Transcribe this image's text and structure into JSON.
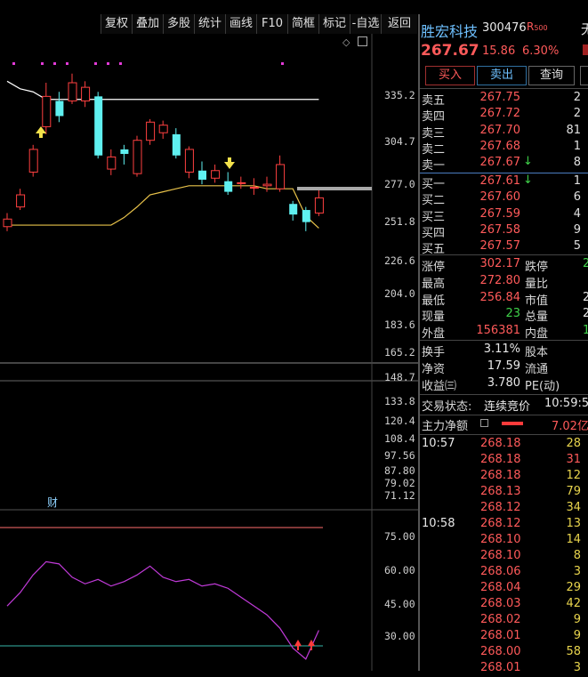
{
  "toolbar": {
    "items": [
      "复权",
      "叠加",
      "多股",
      "统计",
      "画线",
      "F10",
      "简框",
      "标记",
      "-自选",
      "返回"
    ]
  },
  "axis": {
    "price_ticks": [
      "335.2",
      "304.7",
      "277.0",
      "251.8",
      "226.6",
      "204.0",
      "183.6",
      "165.2",
      "148.7",
      "133.8",
      "120.4",
      "108.4",
      "97.56",
      "87.80",
      "79.02",
      "71.12"
    ],
    "indicator_ticks": [
      "75.00",
      "60.00",
      "45.00",
      "30.00"
    ]
  },
  "chart": {
    "fin_marker": "财"
  },
  "stock": {
    "name": "胜宏科技",
    "code": "300476",
    "tag": "R",
    "tag_sub": "500",
    "right_edge": "无",
    "price": "267.67",
    "change": "15.86",
    "pct": "6.30%"
  },
  "actions": {
    "buy": "买入",
    "sell": "卖出",
    "query": "查询"
  },
  "order_book": {
    "asks": [
      {
        "label": "卖五",
        "price": "267.75",
        "vol": "2"
      },
      {
        "label": "卖四",
        "price": "267.72",
        "vol": "2"
      },
      {
        "label": "卖三",
        "price": "267.70",
        "vol": "81"
      },
      {
        "label": "卖二",
        "price": "267.68",
        "vol": "1"
      },
      {
        "label": "卖一",
        "price": "267.67",
        "vol": "8"
      }
    ],
    "bids": [
      {
        "label": "买一",
        "price": "267.61",
        "vol": "1"
      },
      {
        "label": "买二",
        "price": "267.60",
        "vol": "6"
      },
      {
        "label": "买三",
        "price": "267.59",
        "vol": "4"
      },
      {
        "label": "买四",
        "price": "267.58",
        "vol": "9"
      },
      {
        "label": "买五",
        "price": "267.57",
        "vol": "5"
      }
    ]
  },
  "stats": {
    "limit_up_label": "涨停",
    "limit_up": "302.17",
    "limit_down_label": "跌停",
    "limit_down": "2",
    "high_label": "最高",
    "high": "272.80",
    "vol_ratio_label": "量比",
    "vol_ratio": "",
    "low_label": "最低",
    "low": "256.84",
    "mcap_label": "市值",
    "mcap": "2",
    "now_vol_label": "现量",
    "now_vol": "23",
    "total_vol_label": "总量",
    "total_vol": "2",
    "outer_label": "外盘",
    "outer": "156381",
    "inner_label": "内盘",
    "inner": "1",
    "turnover_label": "换手",
    "turnover": "3.11%",
    "equity_label": "股本",
    "equity": "",
    "net_asset_label": "净资",
    "net_asset": "17.59",
    "float_label": "流通",
    "float": "",
    "eps_label": "收益㈢",
    "eps": "3.780",
    "pe_label": "PE(动)",
    "pe": ""
  },
  "status": {
    "label": "交易状态:",
    "value": "连续竞价",
    "time": "10:59:5"
  },
  "main_flow": {
    "label": "主力净额",
    "value": "7.02亿"
  },
  "ticks": [
    {
      "time": "10:57",
      "price": "268.18",
      "vol": "28"
    },
    {
      "time": "",
      "price": "268.18",
      "vol": "31"
    },
    {
      "time": "",
      "price": "268.18",
      "vol": "12"
    },
    {
      "time": "",
      "price": "268.13",
      "vol": "79"
    },
    {
      "time": "",
      "price": "268.12",
      "vol": "34"
    },
    {
      "time": "10:58",
      "price": "268.12",
      "vol": "13"
    },
    {
      "time": "",
      "price": "268.10",
      "vol": "14"
    },
    {
      "time": "",
      "price": "268.10",
      "vol": "8"
    },
    {
      "time": "",
      "price": "268.06",
      "vol": "3"
    },
    {
      "time": "",
      "price": "268.04",
      "vol": "29"
    },
    {
      "time": "",
      "price": "268.03",
      "vol": "42"
    },
    {
      "time": "",
      "price": "268.02",
      "vol": "9"
    },
    {
      "time": "",
      "price": "268.01",
      "vol": "9"
    },
    {
      "time": "",
      "price": "268.00",
      "vol": "58"
    },
    {
      "time": "",
      "price": "268.01",
      "vol": "3"
    }
  ],
  "chart_data": {
    "type": "candlestick",
    "y_axis_price": [
      71.12,
      335.2
    ],
    "candles": [
      {
        "o": 249,
        "c": 254,
        "h": 258,
        "l": 246
      },
      {
        "o": 262,
        "c": 270,
        "h": 274,
        "l": 260
      },
      {
        "o": 285,
        "c": 300,
        "h": 303,
        "l": 282
      },
      {
        "o": 315,
        "c": 335,
        "h": 344,
        "l": 310
      },
      {
        "o": 332,
        "c": 322,
        "h": 338,
        "l": 318
      },
      {
        "o": 332,
        "c": 344,
        "h": 350,
        "l": 330
      },
      {
        "o": 332,
        "c": 341,
        "h": 345,
        "l": 328
      },
      {
        "o": 335,
        "c": 296,
        "h": 338,
        "l": 294
      },
      {
        "o": 287,
        "c": 295,
        "h": 300,
        "l": 283
      },
      {
        "o": 300,
        "c": 297,
        "h": 303,
        "l": 290
      },
      {
        "o": 284,
        "c": 306,
        "h": 309,
        "l": 282
      },
      {
        "o": 306,
        "c": 318,
        "h": 320,
        "l": 303
      },
      {
        "o": 311,
        "c": 316,
        "h": 319,
        "l": 307
      },
      {
        "o": 310,
        "c": 296,
        "h": 314,
        "l": 294
      },
      {
        "o": 285,
        "c": 300,
        "h": 302,
        "l": 281
      },
      {
        "o": 286,
        "c": 280,
        "h": 292,
        "l": 277
      },
      {
        "o": 281,
        "c": 286,
        "h": 290,
        "l": 278
      },
      {
        "o": 279,
        "c": 272,
        "h": 285,
        "l": 270
      },
      {
        "o": 278,
        "c": 278,
        "h": 282,
        "l": 274
      },
      {
        "o": 275,
        "c": 275,
        "h": 281,
        "l": 270
      },
      {
        "o": 276,
        "c": 277,
        "h": 282,
        "l": 272
      },
      {
        "o": 274,
        "c": 290,
        "h": 296,
        "l": 272
      },
      {
        "o": 264,
        "c": 257,
        "h": 266,
        "l": 253
      },
      {
        "o": 260,
        "c": 252,
        "h": 262,
        "l": 246
      },
      {
        "o": 258,
        "c": 268,
        "h": 273,
        "l": 256
      }
    ],
    "upper_band": [
      345,
      340,
      338,
      333,
      333,
      333,
      333,
      333,
      333,
      333,
      333,
      333,
      333,
      333,
      333,
      333,
      333,
      333,
      333,
      333,
      333,
      333,
      333,
      333,
      333
    ],
    "lower_band": [
      250,
      250,
      250,
      250,
      250,
      250,
      250,
      250,
      250,
      255,
      262,
      270,
      272,
      274,
      276,
      276,
      276,
      276,
      276,
      276,
      274,
      274,
      274,
      256,
      248
    ],
    "indicator": [
      44,
      50,
      58,
      64,
      63,
      57,
      54,
      56,
      53,
      55,
      58,
      62,
      57,
      55,
      56,
      53,
      54,
      52,
      48,
      44,
      40,
      34,
      25,
      20,
      33
    ]
  }
}
